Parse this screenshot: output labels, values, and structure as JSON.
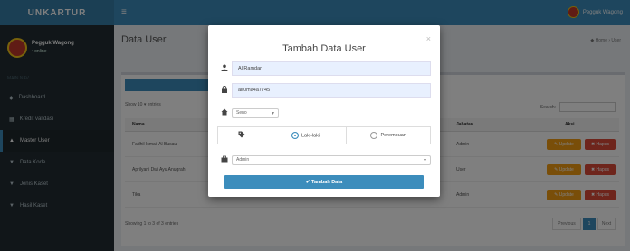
{
  "app": {
    "logo": "UNKARTUR",
    "toggle_icon": "≡",
    "top_user": "Pegguk Wagong"
  },
  "sidebar": {
    "user_name": "Pegguk Wagong",
    "user_status": "• online",
    "header": "MAIN NAV",
    "items": [
      {
        "icon": "◆",
        "label": "Dashboard"
      },
      {
        "icon": "▦",
        "label": "Kredit validasi"
      },
      {
        "icon": "▲",
        "label": "Master User"
      },
      {
        "icon": "▼",
        "label": "Data Kode"
      },
      {
        "icon": "▼",
        "label": "Jenis Kaset"
      },
      {
        "icon": "▼",
        "label": "Hasil Kaset"
      }
    ]
  },
  "page": {
    "title": "Data User",
    "breadcrumb": "◆ Home › User"
  },
  "table": {
    "length_text": "Show 10 ▾ entries",
    "search_label": "Search:",
    "headers": [
      "Nama",
      "Jabatan",
      "Aksi"
    ],
    "rows": [
      {
        "name": "Fadhil Ismail Al Busau",
        "jabatan": "Admin"
      },
      {
        "name": "Aprilyani Dwi Ayu Anugrah",
        "jabatan": "User"
      },
      {
        "name": "Tika",
        "jabatan": "Admin"
      }
    ],
    "edit_label": "✎ Update",
    "delete_label": "✖ Hapus",
    "info": "Showing 1 to 3 of 3 entries",
    "pager": {
      "prev": "Previous",
      "page": "1",
      "next": "Next"
    }
  },
  "modal": {
    "title": "Tambah Data User",
    "close": "×",
    "username_value": "Al Ramdan",
    "password_value": "alr0ma4a7745",
    "home_select": "Seno",
    "gender_option1": "Laki-laki",
    "gender_option2": "Perempuan",
    "role_select": "Admin",
    "submit": "✔ Tambah Data"
  }
}
